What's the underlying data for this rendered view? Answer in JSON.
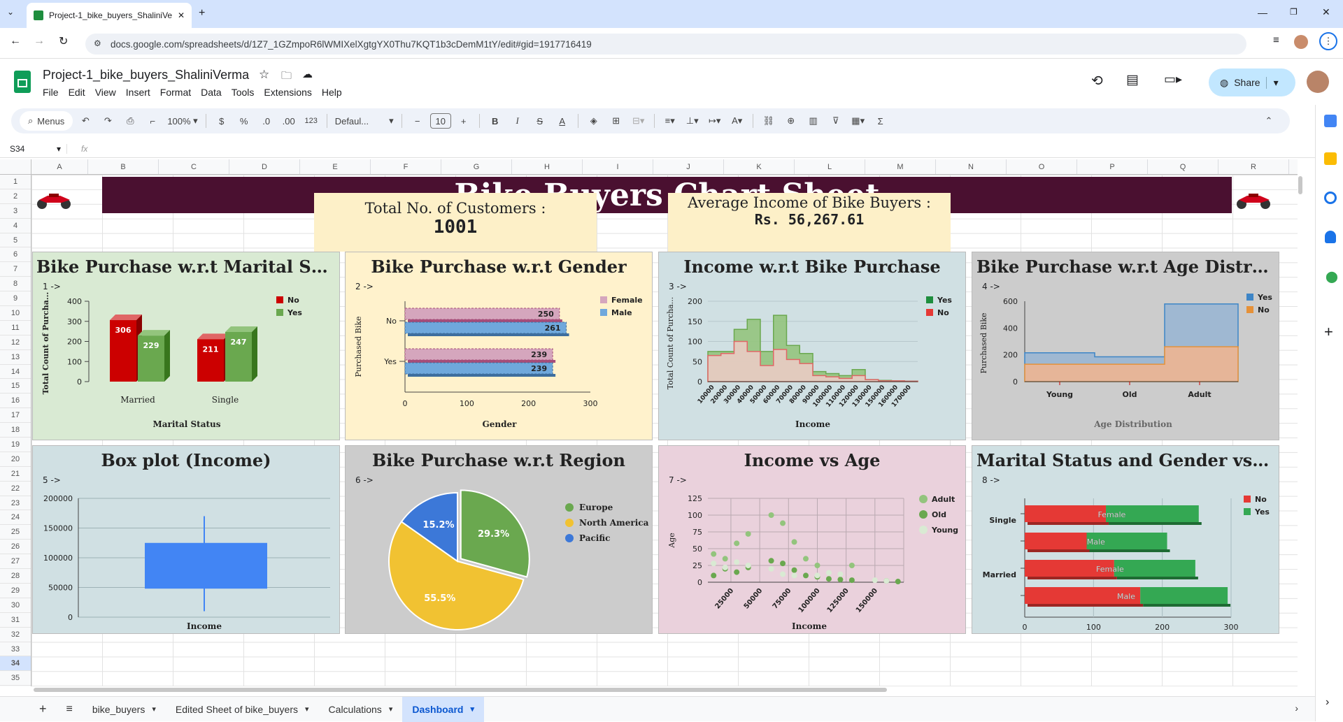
{
  "browser": {
    "tab_title": "Project-1_bike_buyers_ShaliniVe",
    "url": "docs.google.com/spreadsheets/d/1Z7_1GZmpoR6lWMIXelXgtgYX0Thu7KQT1b3cDemM1tY/edit#gid=1917716419"
  },
  "doc": {
    "title": "Project-1_bike_buyers_ShaliniVerma",
    "share": "Share",
    "menus": [
      "File",
      "Edit",
      "View",
      "Insert",
      "Format",
      "Data",
      "Tools",
      "Extensions",
      "Help"
    ]
  },
  "toolbar": {
    "search": "Menus",
    "zoom": "100%",
    "currency": "$",
    "percent": "%",
    "dec_minus": ".0",
    "dec_plus": ".00",
    "num": "123",
    "font": "Defaul...",
    "size": "10",
    "minus": "−",
    "plus": "+"
  },
  "formula": {
    "cell": "S34",
    "fx": "fx"
  },
  "columns": [
    "A",
    "B",
    "C",
    "D",
    "E",
    "F",
    "G",
    "H",
    "I",
    "J",
    "K",
    "L",
    "M",
    "N",
    "O",
    "P",
    "Q",
    "R"
  ],
  "rows": [
    "1",
    "2",
    "3",
    "4",
    "5",
    "6",
    "7",
    "8",
    "9",
    "10",
    "11",
    "12",
    "13",
    "14",
    "15",
    "16",
    "17",
    "18",
    "19",
    "20",
    "21",
    "22",
    "23",
    "24",
    "25",
    "26",
    "27",
    "28",
    "29",
    "30",
    "31",
    "32",
    "33",
    "34",
    "35"
  ],
  "dashboard": {
    "banner": "Bike Buyers Chart Sheet",
    "kpi1_label": "Total No. of Customers :",
    "kpi1_value": "1001",
    "kpi2_label": "Average Income of Bike Buyers :",
    "kpi2_value": "Rs. 56,267.61"
  },
  "colors": {
    "banner": "#4a1030",
    "kpi_bg": "#fdf0c8",
    "green_panel": "#d9ead3",
    "yellow_panel": "#fff2cc",
    "blue_panel": "#d0e0e3",
    "grey_panel": "#cccccc",
    "pink_panel": "#ead1dc"
  },
  "panels": [
    {
      "title": "Bike Purchase w.r.t Marital Sta...",
      "num": "1 ->"
    },
    {
      "title": "Bike Purchase w.r.t Gender",
      "num": "2 ->"
    },
    {
      "title": "Income w.r.t Bike Purchase",
      "num": "3 ->"
    },
    {
      "title": "Bike Purchase w.r.t Age Distrib...",
      "num": "4 ->"
    },
    {
      "title": "Box plot (Income)",
      "num": "5 ->"
    },
    {
      "title": "Bike Purchase w.r.t Region",
      "num": "6 ->"
    },
    {
      "title": "Income vs Age",
      "num": "7 ->"
    },
    {
      "title": "Marital Status and Gender vs B...",
      "num": "8 ->"
    }
  ],
  "chart_data": [
    {
      "type": "bar",
      "categories": [
        "Married",
        "Single"
      ],
      "series": [
        {
          "name": "No",
          "values": [
            306,
            211
          ]
        },
        {
          "name": "Yes",
          "values": [
            229,
            247
          ]
        }
      ],
      "xlabel": "Marital Status",
      "ylabel": "Total Count of Purcha...",
      "ylim": [
        0,
        400
      ],
      "yticks": [
        "0",
        "100",
        "200",
        "300",
        "400"
      ],
      "legend": "top-right"
    },
    {
      "type": "bar",
      "orientation": "horizontal",
      "categories": [
        "No",
        "Yes"
      ],
      "series": [
        {
          "name": "Female",
          "values": [
            250,
            239
          ]
        },
        {
          "name": "Male",
          "values": [
            261,
            239
          ]
        }
      ],
      "xlabel": "Gender",
      "ylabel": "Purchased Bike",
      "xlim": [
        0,
        300
      ],
      "xticks": [
        "0",
        "100",
        "200",
        "300"
      ],
      "legend": "top-right"
    },
    {
      "type": "area",
      "x": [
        "10000",
        "20000",
        "30000",
        "40000",
        "50000",
        "60000",
        "70000",
        "80000",
        "90000",
        "100000",
        "110000",
        "120000",
        "130000",
        "150000",
        "160000",
        "170000"
      ],
      "series": [
        {
          "name": "Yes",
          "values": [
            75,
            75,
            130,
            155,
            75,
            165,
            90,
            70,
            25,
            20,
            15,
            30,
            5,
            3,
            2,
            1
          ]
        },
        {
          "name": "No",
          "values": [
            65,
            70,
            100,
            75,
            40,
            80,
            55,
            45,
            15,
            12,
            8,
            15,
            5,
            2,
            2,
            1
          ]
        }
      ],
      "xlabel": "Income",
      "ylabel": "Total Count of Purcha...",
      "ylim": [
        0,
        200
      ],
      "yticks": [
        "0",
        "50",
        "100",
        "150",
        "200"
      ],
      "legend": "top-right"
    },
    {
      "type": "area",
      "x": [
        "Young",
        "Old",
        "Adult"
      ],
      "series": [
        {
          "name": "Yes",
          "values": [
            215,
            185,
            580
          ]
        },
        {
          "name": "No",
          "values": [
            130,
            130,
            260
          ]
        }
      ],
      "xlabel": "Age Distribution",
      "ylabel": "Purchased Bike",
      "ylim": [
        0,
        600
      ],
      "yticks": [
        "0",
        "200",
        "400",
        "600"
      ],
      "legend": "top-right"
    },
    {
      "type": "box",
      "category": "Income",
      "min": 10000,
      "q1": 48000,
      "q3": 125000,
      "max": 170000,
      "ylim": [
        0,
        200000
      ],
      "yticks": [
        "0",
        "50000",
        "100000",
        "150000",
        "200000"
      ],
      "xlabel": "Income"
    },
    {
      "type": "pie",
      "series": [
        {
          "name": "Europe",
          "value": 29.3,
          "label": "29.3%"
        },
        {
          "name": "North America",
          "value": 55.5,
          "label": "55.5%"
        },
        {
          "name": "Pacific",
          "value": 15.2,
          "label": "15.2%"
        }
      ],
      "legend": "right"
    },
    {
      "type": "scatter",
      "series": [
        {
          "name": "Adult",
          "points": [
            [
              10000,
              42
            ],
            [
              20000,
              35
            ],
            [
              30000,
              58
            ],
            [
              40000,
              72
            ],
            [
              60000,
              100
            ],
            [
              70000,
              88
            ],
            [
              80000,
              60
            ],
            [
              90000,
              35
            ],
            [
              100000,
              25
            ],
            [
              130000,
              25
            ]
          ]
        },
        {
          "name": "Old",
          "points": [
            [
              10000,
              10
            ],
            [
              20000,
              20
            ],
            [
              30000,
              15
            ],
            [
              40000,
              22
            ],
            [
              60000,
              32
            ],
            [
              70000,
              28
            ],
            [
              80000,
              18
            ],
            [
              90000,
              10
            ],
            [
              100000,
              8
            ],
            [
              110000,
              5
            ],
            [
              120000,
              4
            ],
            [
              130000,
              3
            ],
            [
              160000,
              2
            ],
            [
              170000,
              1
            ]
          ]
        },
        {
          "name": "Young",
          "points": [
            [
              10000,
              28
            ],
            [
              20000,
              22
            ],
            [
              30000,
              30
            ],
            [
              40000,
              25
            ],
            [
              60000,
              20
            ],
            [
              70000,
              12
            ],
            [
              80000,
              10
            ],
            [
              100000,
              10
            ],
            [
              110000,
              14
            ],
            [
              120000,
              12
            ],
            [
              150000,
              3
            ],
            [
              160000,
              2
            ]
          ]
        }
      ],
      "xlabel": "Income",
      "ylabel": "Age",
      "ylim": [
        0,
        125
      ],
      "yticks": [
        "0",
        "25",
        "50",
        "75",
        "100",
        "125"
      ],
      "xticks": [
        "25000",
        "50000",
        "75000",
        "100000",
        "125000",
        "150000"
      ],
      "legend": "top-right"
    },
    {
      "type": "bar",
      "orientation": "horizontal",
      "stacked": true,
      "categories": [
        "Single - Female",
        "Single - Male",
        "Married - Female",
        "Married - Male"
      ],
      "groups": [
        "Single",
        "Married"
      ],
      "bar_labels": [
        "Female",
        "Male",
        "Female",
        "Male"
      ],
      "series": [
        {
          "name": "No",
          "values": [
            118,
            90,
            130,
            168
          ]
        },
        {
          "name": "Yes",
          "values": [
            135,
            117,
            118,
            127
          ]
        }
      ],
      "xlim": [
        0,
        300
      ],
      "xticks": [
        "0",
        "100",
        "200",
        "300"
      ],
      "legend": "top-right"
    }
  ],
  "sheet_tabs": [
    "bike_buyers",
    "Edited Sheet of bike_buyers",
    "Calculations",
    "Dashboard"
  ]
}
